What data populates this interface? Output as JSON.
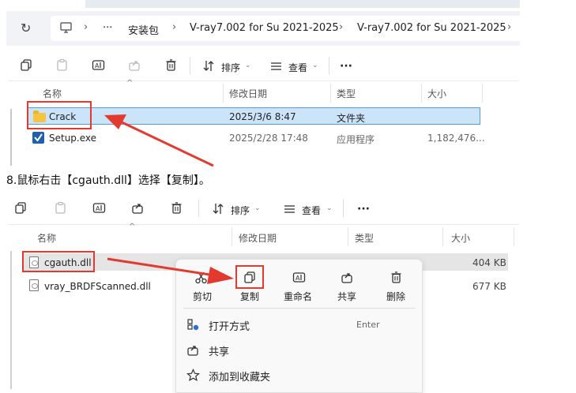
{
  "screen1": {
    "breadcrumb": [
      "安装包",
      "V-ray7.002  for Su 2021-2025",
      "V-ray7.002  for Su 2021-2025"
    ],
    "more_crumbs": "···",
    "toolbar": {
      "sort_label": "排序",
      "view_label": "查看",
      "more_label": "···"
    },
    "columns": {
      "name": "名称",
      "date": "修改日期",
      "type": "类型",
      "size": "大小"
    },
    "rows": [
      {
        "name": "Crack",
        "date": "2025/3/6 8:47",
        "type": "文件夹",
        "size": ""
      },
      {
        "name": "Setup.exe",
        "date": "2025/2/28 17:48",
        "type": "应用程序",
        "size": "1,182,476..."
      }
    ]
  },
  "caption": "8.鼠标右击【cgauth.dll】选择【复制】。",
  "screen2": {
    "toolbar": {
      "sort_label": "排序",
      "view_label": "查看",
      "more_label": "···"
    },
    "columns": {
      "name": "名称",
      "date": "修改日期",
      "type": "类型",
      "size": "大小"
    },
    "rows": [
      {
        "name": "cgauth.dll",
        "size": "404 KB"
      },
      {
        "name": "vray_BRDFScanned.dll",
        "size": "677 KB"
      }
    ],
    "context_menu": {
      "quick_actions": [
        "剪切",
        "复制",
        "重命名",
        "共享",
        "删除"
      ],
      "items": [
        {
          "label": "打开方式",
          "shortcut": "Enter"
        },
        {
          "label": "共享",
          "shortcut": ""
        },
        {
          "label": "添加到收藏夹",
          "shortcut": ""
        }
      ]
    }
  },
  "colors": {
    "highlight": "#e33a2f",
    "selection": "#cce4f7",
    "selection_border": "#5a9bd5"
  }
}
